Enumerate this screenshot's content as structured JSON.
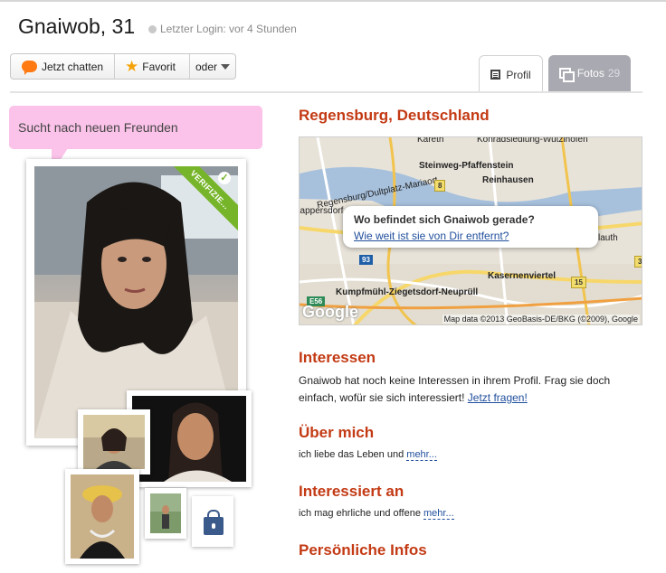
{
  "header": {
    "name_age": "Gnaiwob, 31",
    "last_login": "Letzter Login: vor 4 Stunden"
  },
  "actions": {
    "chat_label": "Jetzt chatten",
    "favorite_label": "Favorit",
    "more_label": "oder"
  },
  "tabs": [
    {
      "label": "Profil",
      "active": true
    },
    {
      "label": "Fotos",
      "count": "29",
      "active": false
    }
  ],
  "status_bubble": "Sucht nach neuen Freunden",
  "photo": {
    "badge": "VERIFIZIE..."
  },
  "location": {
    "title": "Regensburg, Deutschland",
    "map_question": "Wo befindet sich Gnaiwob gerade?",
    "map_link": "Wie weit ist sie von Dir entfernt?",
    "map_labels": [
      "Konradsiedlung-Wutzlhofen",
      "Steinweg-Pfaffenstein",
      "Reinhausen",
      "Regensburg/Dultplatz-Mariaort",
      "Kasernenviertel",
      "Kumpfmühl-Ziegetsdorf-Neuprüll",
      "Kareth",
      "Lappersdorf",
      "lauth"
    ],
    "road_labels": [
      "8",
      "93",
      "15",
      "E56",
      "3"
    ],
    "map_logo": "Google",
    "attribution": "Map data ©2013 GeoBasis-DE/BKG (©2009), Google"
  },
  "interests": {
    "title": "Interessen",
    "text": "Gnaiwob hat noch keine Interessen in ihrem Profil. Frag sie doch einfach, wofür sie sich interessiert!",
    "link": "Jetzt fragen!"
  },
  "about": {
    "title": "Über mich",
    "text": "ich liebe das Leben und",
    "more": "mehr..."
  },
  "interested_in": {
    "title": "Interessiert an",
    "text": "ich mag ehrliche und offene",
    "more": "mehr..."
  },
  "personal": {
    "title": "Persönliche Infos"
  },
  "colors": {
    "heading": "#c33a14",
    "link": "#1f4e9c",
    "bubble": "#fbc3e9",
    "verified": "#76b52a",
    "tab_inactive": "#a9a9b1"
  }
}
